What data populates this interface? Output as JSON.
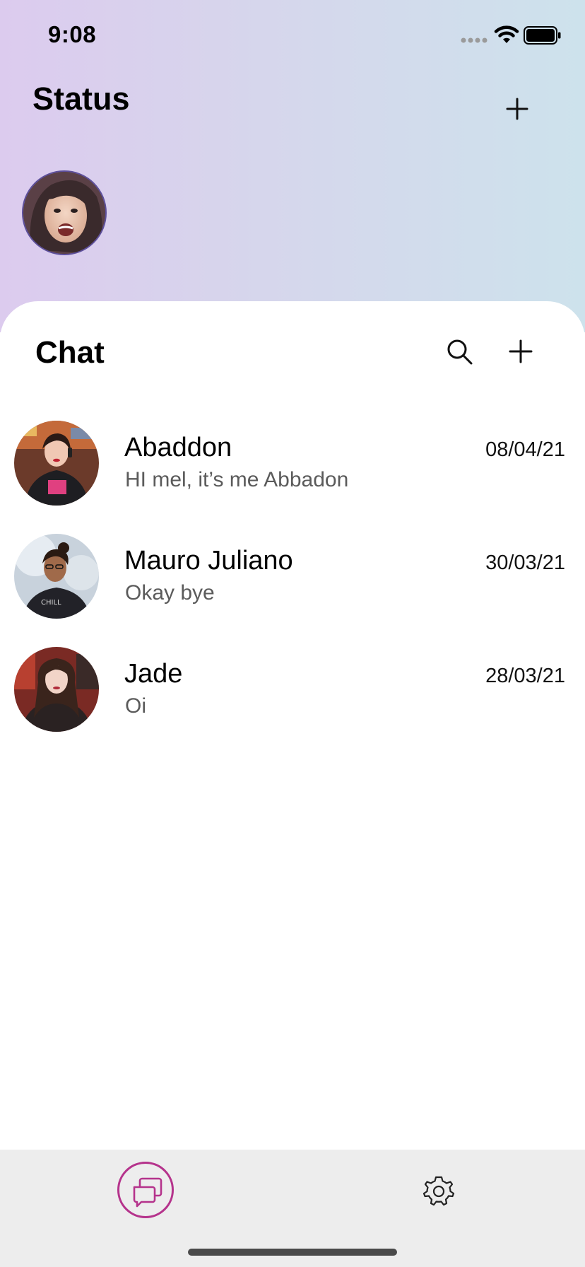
{
  "status_bar": {
    "time": "9:08",
    "signal_icon": "signal-dots-icon",
    "wifi_icon": "wifi-icon",
    "battery_icon": "battery-icon"
  },
  "status_section": {
    "title": "Status",
    "add_icon": "plus-icon"
  },
  "chat_section": {
    "title": "Chat",
    "search_icon": "search-icon",
    "add_icon": "plus-icon"
  },
  "chats": [
    {
      "name": "Abaddon",
      "message": "HI mel, it’s me Abbadon",
      "date": "08/04/21"
    },
    {
      "name": "Mauro Juliano",
      "message": "Okay bye",
      "date": "30/03/21"
    },
    {
      "name": "Jade",
      "message": "Oi",
      "date": "28/03/21"
    }
  ],
  "tab_bar": {
    "chats_icon": "chat-bubbles-icon",
    "settings_icon": "gear-icon"
  },
  "colors": {
    "accent": "#b5338c",
    "gradient_start": "#dccbee",
    "gradient_end": "#cde2ec",
    "tab_bar_bg": "#ededed",
    "secondary_text": "#5b5b5b"
  }
}
